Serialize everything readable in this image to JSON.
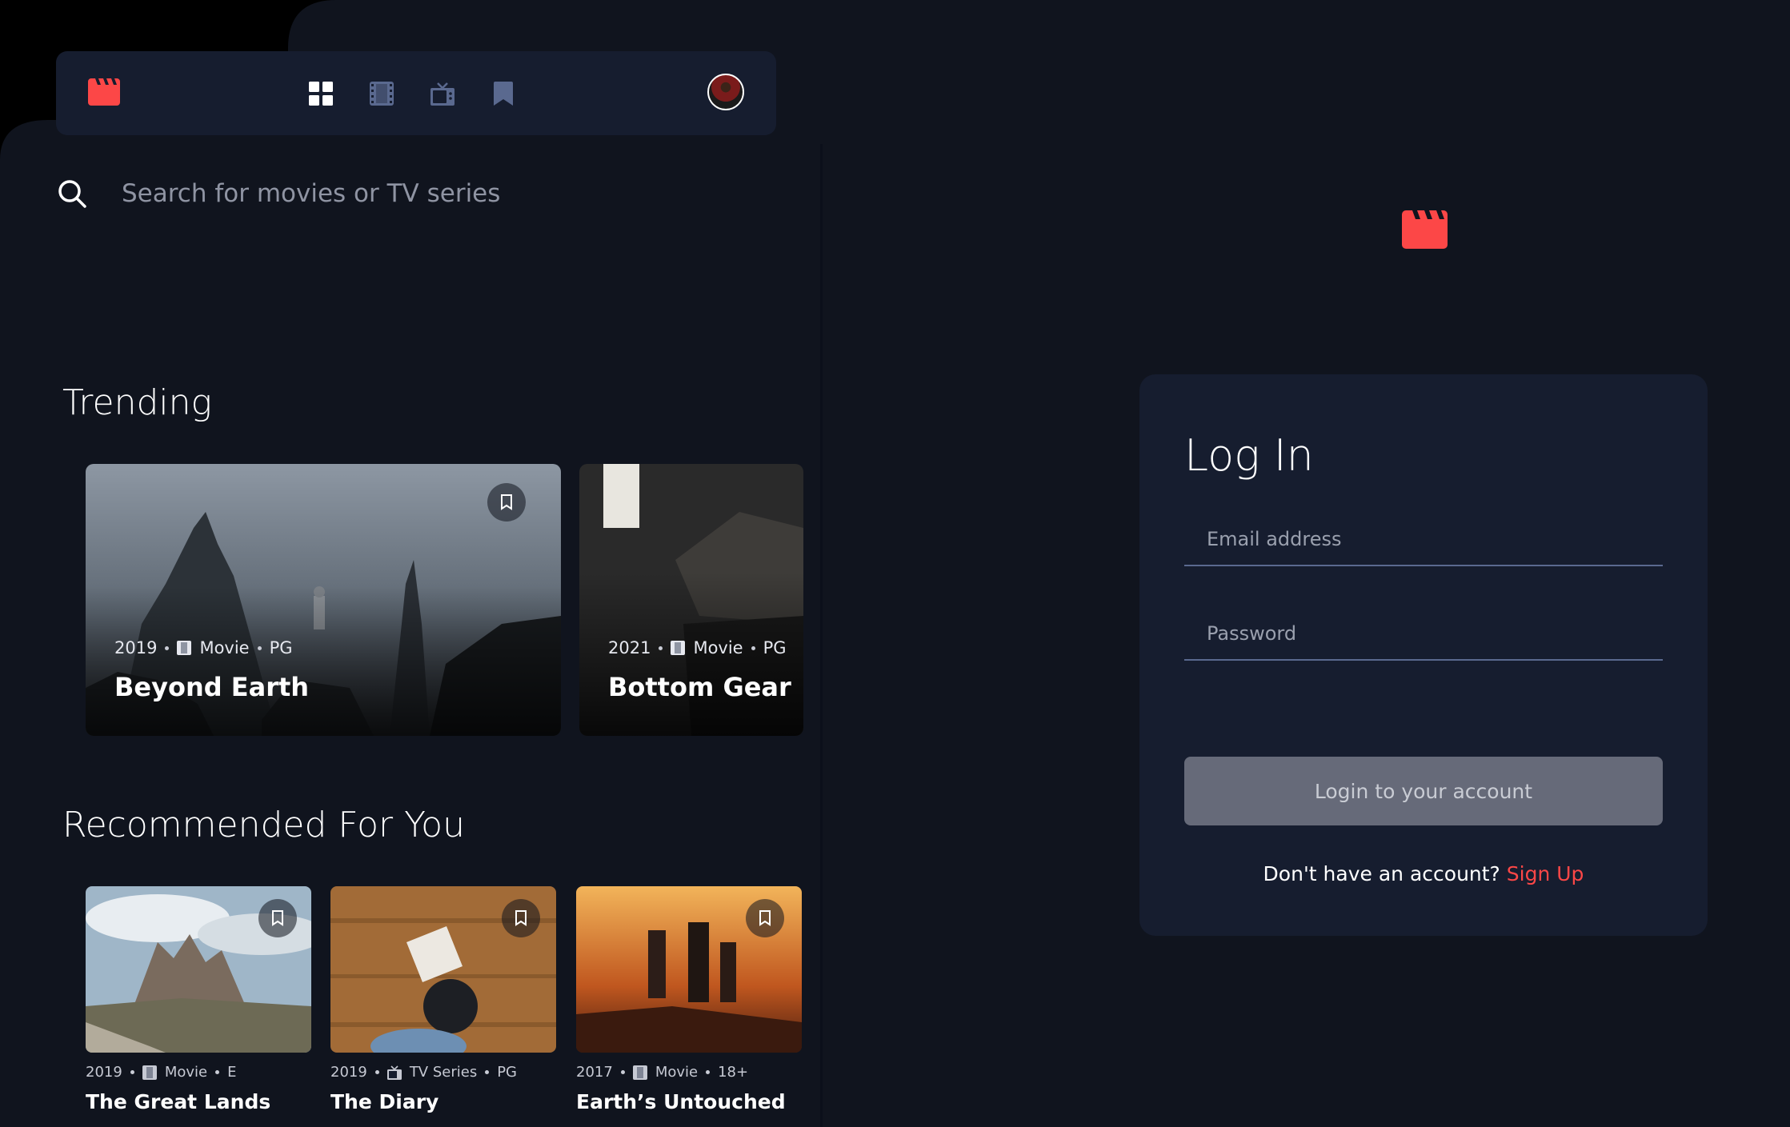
{
  "colors": {
    "background": "#10141e",
    "panel": "#161d2f",
    "accent": "#fc4747",
    "nav_icon": "#5a698f",
    "button_disabled": "#666a79"
  },
  "nav": {
    "logo_icon": "clapperboard-icon",
    "icons": [
      "grid-icon",
      "film-icon",
      "tv-icon",
      "bookmark-icon"
    ],
    "avatar": "user-avatar"
  },
  "search": {
    "placeholder": "Search for movies or TV series",
    "icon": "search-icon"
  },
  "trending": {
    "heading": "Trending",
    "items": [
      {
        "year": "2019",
        "category": "Movie",
        "rating": "PG",
        "title": "Beyond Earth"
      },
      {
        "year": "2021",
        "category": "Movie",
        "rating": "PG",
        "title": "Bottom Gear"
      }
    ]
  },
  "recommended": {
    "heading": "Recommended For You",
    "items": [
      {
        "year": "2019",
        "category": "Movie",
        "rating": "E",
        "title": "The Great Lands"
      },
      {
        "year": "2019",
        "category": "TV Series",
        "rating": "PG",
        "title": "The Diary"
      },
      {
        "year": "2017",
        "category": "Movie",
        "rating": "18+",
        "title": "Earth’s Untouched"
      }
    ]
  },
  "login": {
    "title": "Log In",
    "email_placeholder": "Email address",
    "password_placeholder": "Password",
    "button_label": "Login to your account",
    "signup_prompt": "Don't have an account?",
    "signup_link": "Sign Up"
  }
}
